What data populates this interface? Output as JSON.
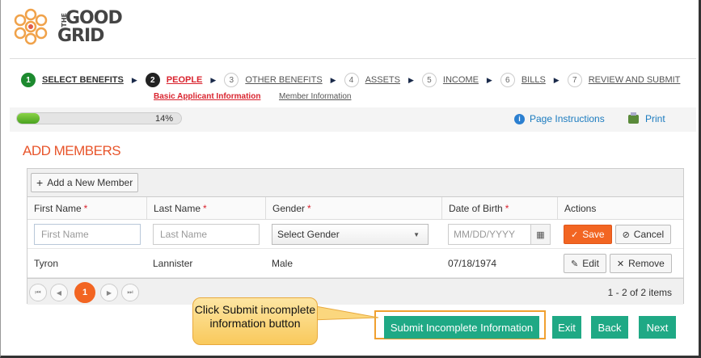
{
  "brand": {
    "logo_top": "THE",
    "logo_line1": "GOOD",
    "logo_line2": "GRID"
  },
  "steps": [
    {
      "num": "1",
      "label": "SELECT BENEFITS",
      "state": "done"
    },
    {
      "num": "2",
      "label": "PEOPLE",
      "state": "active"
    },
    {
      "num": "3",
      "label": "OTHER BENEFITS",
      "state": "inactive"
    },
    {
      "num": "4",
      "label": "ASSETS",
      "state": "inactive"
    },
    {
      "num": "5",
      "label": "INCOME",
      "state": "inactive"
    },
    {
      "num": "6",
      "label": "BILLS",
      "state": "inactive"
    },
    {
      "num": "7",
      "label": "REVIEW AND SUBMIT",
      "state": "inactive"
    }
  ],
  "substeps": [
    {
      "label": "Basic Applicant Information",
      "state": "active"
    },
    {
      "label": "Member Information",
      "state": "inactive"
    }
  ],
  "progress": {
    "text": "14%",
    "value": 14
  },
  "links": {
    "page_instructions": "Page Instructions",
    "print": "Print"
  },
  "section_title": "ADD MEMBERS",
  "grid": {
    "add_button": "Add a New Member",
    "columns": [
      {
        "label": "First Name",
        "required": "*"
      },
      {
        "label": "Last Name",
        "required": "*"
      },
      {
        "label": "Gender",
        "required": "*"
      },
      {
        "label": "Date of Birth",
        "required": "*"
      },
      {
        "label": "Actions",
        "required": ""
      }
    ],
    "edit_row": {
      "first_name_placeholder": "First Name",
      "last_name_placeholder": "Last Name",
      "gender_value": "Select Gender",
      "dob_placeholder": "MM/DD/YYYY",
      "save_label": "Save",
      "cancel_label": "Cancel"
    },
    "rows": [
      {
        "first_name": "Tyron",
        "last_name": "Lannister",
        "gender": "Male",
        "dob": "07/18/1974",
        "edit_label": "Edit",
        "remove_label": "Remove"
      }
    ],
    "pager": {
      "current_page": "1",
      "info": "1 - 2 of 2 items"
    }
  },
  "footer": {
    "submit_incomplete": "Submit Incomplete Information",
    "exit": "Exit",
    "back": "Back",
    "next": "Next"
  },
  "callout": {
    "text": "Click Submit incomplete information button"
  },
  "colors": {
    "accent_orange": "#f26522",
    "teal_button": "#1fa985",
    "red_active": "#d9232e",
    "link_blue": "#1b7bbf"
  }
}
